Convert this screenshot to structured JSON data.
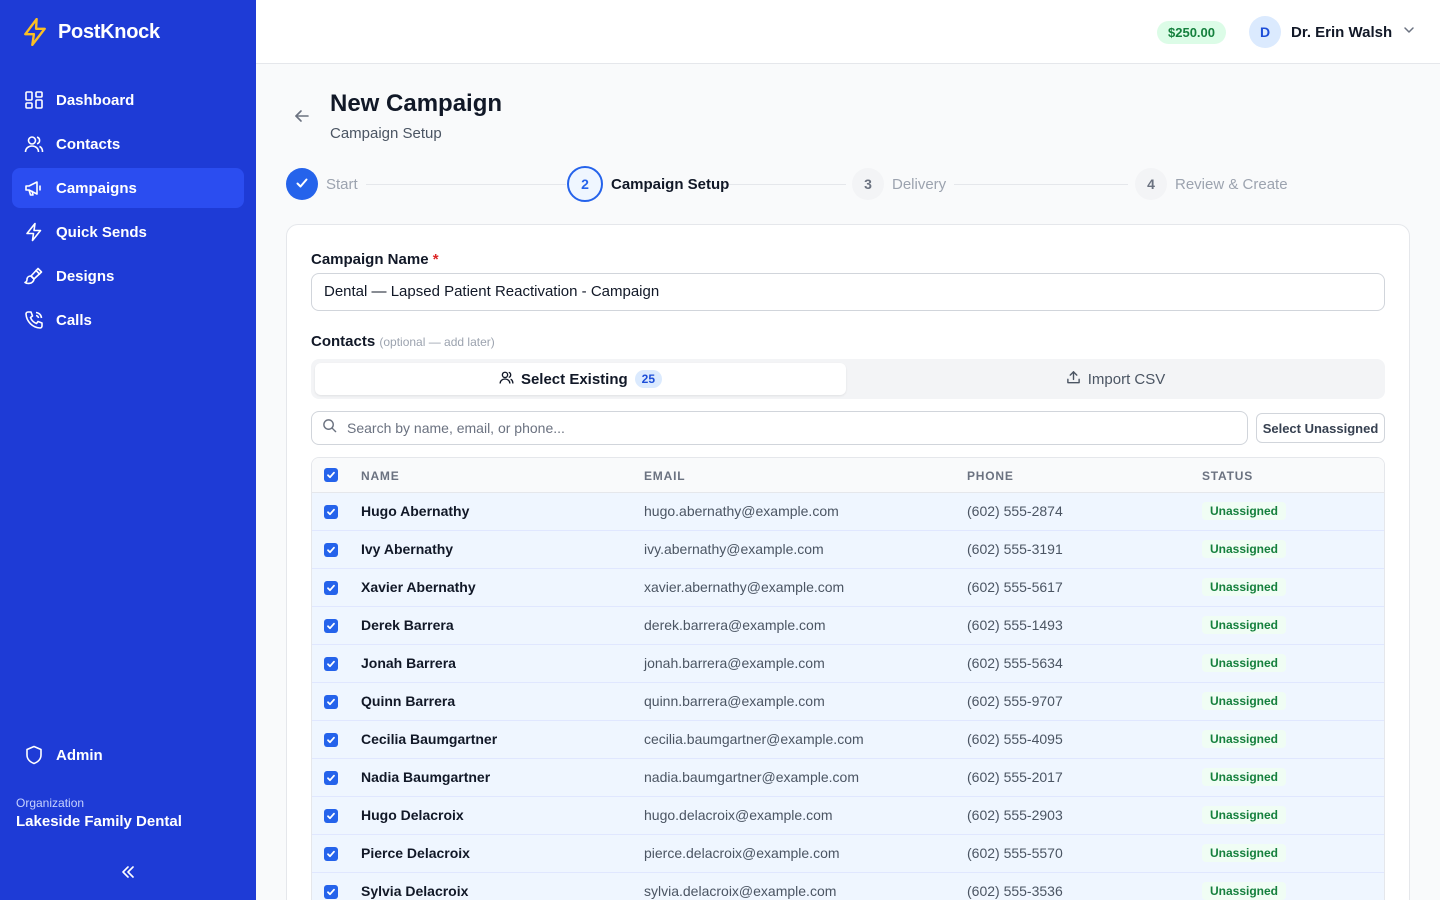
{
  "app": {
    "name": "PostKnock"
  },
  "sidebar": {
    "items": [
      {
        "label": "Dashboard",
        "icon": "dashboard-icon"
      },
      {
        "label": "Contacts",
        "icon": "users-icon"
      },
      {
        "label": "Campaigns",
        "icon": "megaphone-icon",
        "active": true
      },
      {
        "label": "Quick Sends",
        "icon": "lightning-icon"
      },
      {
        "label": "Designs",
        "icon": "paint-brush-icon"
      },
      {
        "label": "Calls",
        "icon": "phone-icon"
      }
    ],
    "admin_label": "Admin",
    "org_label": "Organization",
    "org_name": "Lakeside Family Dental"
  },
  "topbar": {
    "balance": "$250.00",
    "avatar_initial": "D",
    "user_name": "Dr. Erin Walsh"
  },
  "header": {
    "title": "New Campaign",
    "subtitle": "Campaign Setup"
  },
  "stepper": {
    "steps": [
      {
        "number": "1",
        "label": "Start",
        "state": "done"
      },
      {
        "number": "2",
        "label": "Campaign Setup",
        "state": "current"
      },
      {
        "number": "3",
        "label": "Delivery",
        "state": "todo"
      },
      {
        "number": "4",
        "label": "Review & Create",
        "state": "todo"
      }
    ]
  },
  "form": {
    "name_label": "Campaign Name",
    "required_mark": "*",
    "name_value": "Dental — Lapsed Patient Reactivation - Campaign",
    "contacts_label": "Contacts",
    "contacts_hint": "(optional — add later)",
    "tab_existing": "Select Existing",
    "tab_existing_count": "25",
    "tab_import": "Import CSV",
    "search_placeholder": "Search by name, email, or phone...",
    "select_unassigned": "Select Unassigned"
  },
  "table": {
    "columns": [
      "NAME",
      "EMAIL",
      "PHONE",
      "STATUS"
    ],
    "rows": [
      {
        "name": "Hugo Abernathy",
        "email": "hugo.abernathy@example.com",
        "phone": "(602) 555-2874",
        "status": "Unassigned"
      },
      {
        "name": "Ivy Abernathy",
        "email": "ivy.abernathy@example.com",
        "phone": "(602) 555-3191",
        "status": "Unassigned"
      },
      {
        "name": "Xavier Abernathy",
        "email": "xavier.abernathy@example.com",
        "phone": "(602) 555-5617",
        "status": "Unassigned"
      },
      {
        "name": "Derek Barrera",
        "email": "derek.barrera@example.com",
        "phone": "(602) 555-1493",
        "status": "Unassigned"
      },
      {
        "name": "Jonah Barrera",
        "email": "jonah.barrera@example.com",
        "phone": "(602) 555-5634",
        "status": "Unassigned"
      },
      {
        "name": "Quinn Barrera",
        "email": "quinn.barrera@example.com",
        "phone": "(602) 555-9707",
        "status": "Unassigned"
      },
      {
        "name": "Cecilia Baumgartner",
        "email": "cecilia.baumgartner@example.com",
        "phone": "(602) 555-4095",
        "status": "Unassigned"
      },
      {
        "name": "Nadia Baumgartner",
        "email": "nadia.baumgartner@example.com",
        "phone": "(602) 555-2017",
        "status": "Unassigned"
      },
      {
        "name": "Hugo Delacroix",
        "email": "hugo.delacroix@example.com",
        "phone": "(602) 555-2903",
        "status": "Unassigned"
      },
      {
        "name": "Pierce Delacroix",
        "email": "pierce.delacroix@example.com",
        "phone": "(602) 555-5570",
        "status": "Unassigned"
      },
      {
        "name": "Sylvia Delacroix",
        "email": "sylvia.delacroix@example.com",
        "phone": "(602) 555-3536",
        "status": "Unassigned"
      }
    ]
  },
  "colors": {
    "sidebar_bg": "#1e3bd6",
    "accent": "#2563eb",
    "status_green": "#15803d",
    "logo_yellow": "#fbbf24"
  }
}
